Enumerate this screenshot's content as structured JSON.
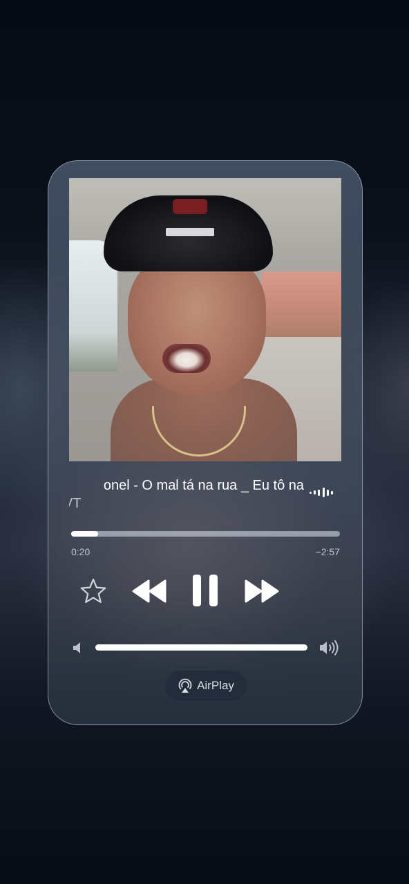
{
  "now_playing": {
    "title": "onel - O mal tá na rua _ Eu tô na",
    "artist": "VT",
    "elapsed": "0:20",
    "remaining": "−2:57",
    "progress_fraction": 0.1,
    "volume_fraction": 1.0,
    "playing": true
  },
  "controls": {
    "favorite_icon": "star-outline-icon",
    "rewind_icon": "rewind-icon",
    "pause_icon": "pause-icon",
    "forward_icon": "fast-forward-icon",
    "volume_low_icon": "speaker-low-icon",
    "volume_high_icon": "speaker-high-icon",
    "waveform_icon": "audio-waveform-icon"
  },
  "airplay": {
    "label": "AirPlay",
    "icon": "airplay-icon"
  },
  "colors": {
    "accent": "#ffffff",
    "track": "#dce4f0",
    "card": "#505f73",
    "background": "#070b14"
  }
}
